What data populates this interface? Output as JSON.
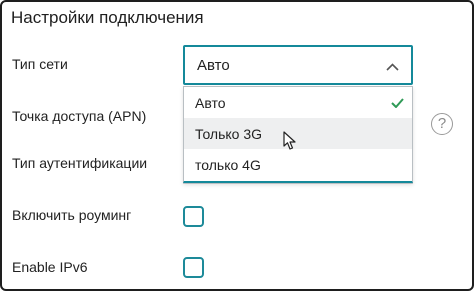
{
  "title": "Настройки подключения",
  "fields": {
    "network_type_label": "Тип сети",
    "apn_label": "Точка доступа (APN)",
    "auth_type_label": "Тип аутентификации",
    "roaming_label": "Включить роуминг",
    "ipv6_label": "Enable IPv6"
  },
  "network_select": {
    "value": "Авто",
    "options": [
      {
        "label": "Авто",
        "selected": true
      },
      {
        "label": "Только 3G",
        "selected": false
      },
      {
        "label": "только 4G",
        "selected": false
      }
    ]
  },
  "help_glyph": "?",
  "colors": {
    "accent": "#14899a",
    "check": "#2f9a57",
    "hover_bg": "#eeeff0"
  },
  "icons": {
    "select": "chevron-up-icon",
    "selected_option": "check-icon",
    "help": "question-circle-icon",
    "pointer": "mouse-cursor-icon"
  },
  "checkboxes": {
    "roaming_checked": false,
    "ipv6_checked": false
  }
}
